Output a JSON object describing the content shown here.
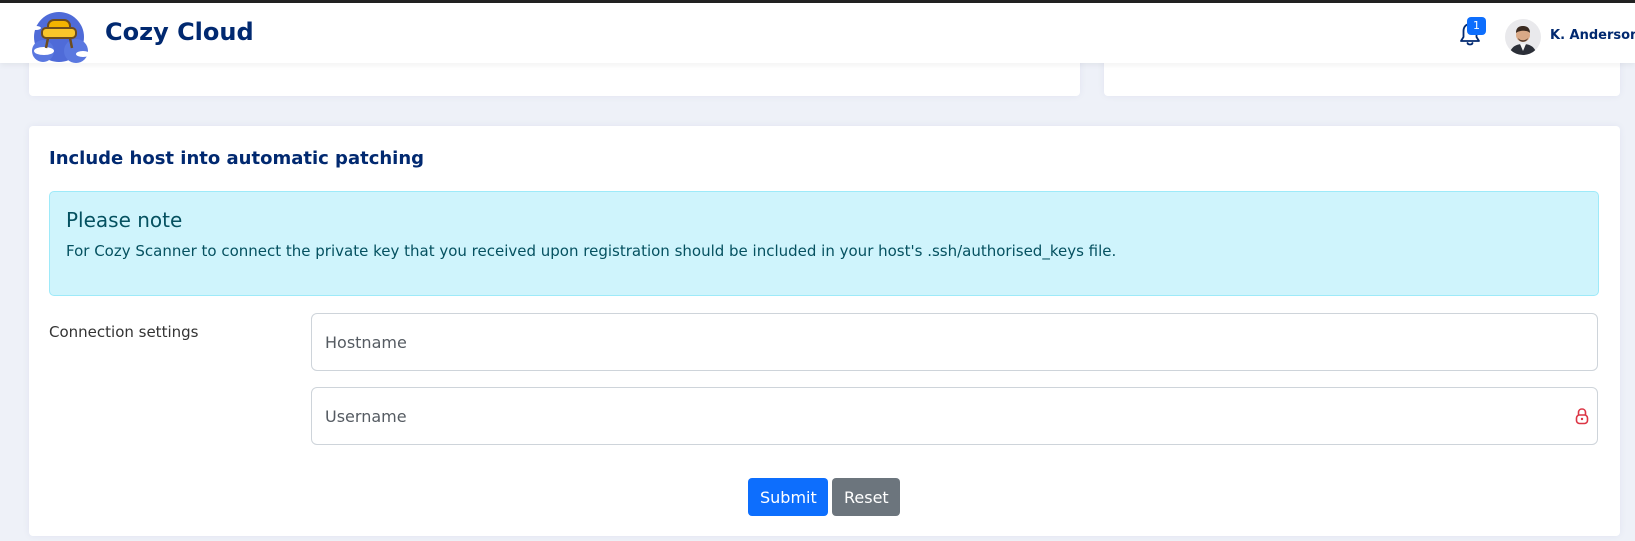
{
  "header": {
    "brand": "Cozy Cloud",
    "notifications_count": "1",
    "user_name": "K. Anderson"
  },
  "card": {
    "title": "Include host into automatic patching",
    "alert": {
      "heading": "Please note",
      "text": "For Cozy Scanner to connect the private key that you received upon registration should be included in your host's .ssh/authorised_keys file."
    },
    "connection_label": "Connection settings",
    "hostname": {
      "value": "",
      "placeholder": "Hostname"
    },
    "username": {
      "value": "",
      "placeholder": "Username"
    },
    "submit_label": "Submit",
    "reset_label": "Reset"
  },
  "colors": {
    "brand": "#012970",
    "primary": "#0d6efd",
    "secondary": "#6c757d",
    "alert_bg": "#cff4fc",
    "alert_text": "#055160",
    "page_bg": "#eef1f8",
    "password_icon": "#dc3545"
  },
  "icons": {
    "logo": "cloud-armchair-logo",
    "notifications": "bell-icon",
    "password_manager": "password-manager-icon"
  }
}
